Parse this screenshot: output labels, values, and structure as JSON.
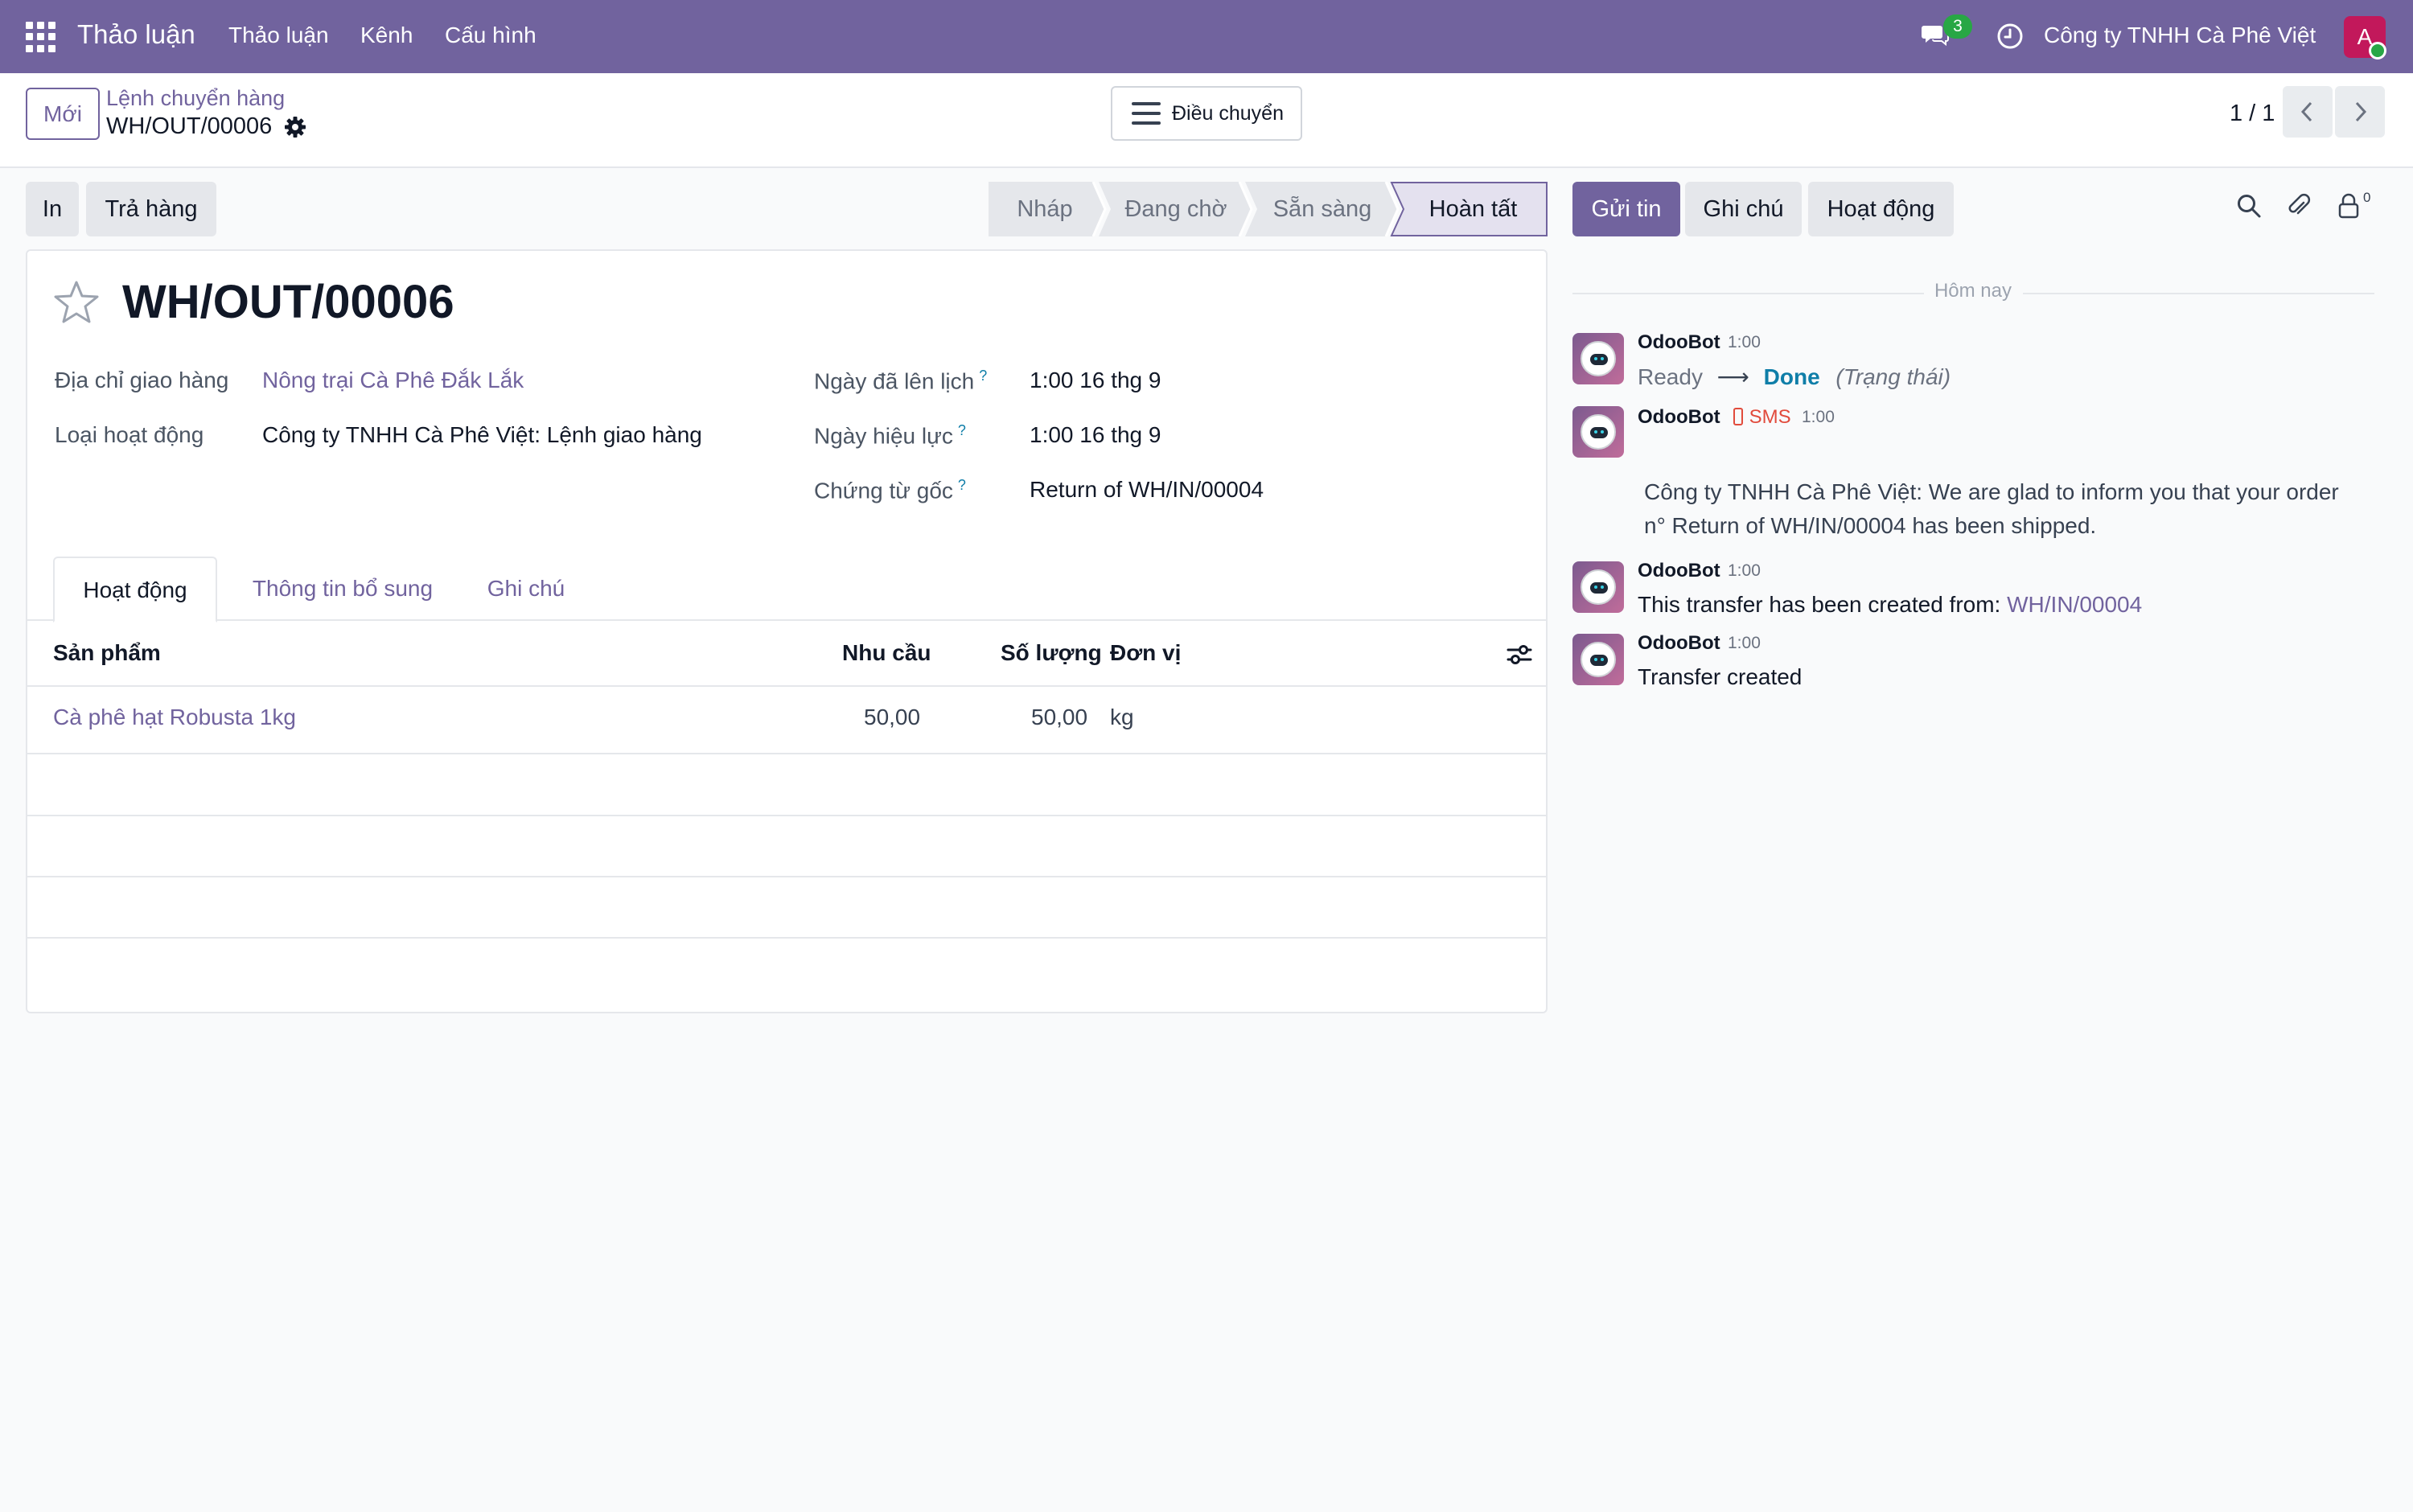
{
  "navbar": {
    "app_name": "Thảo luận",
    "menu": [
      "Thảo luận",
      "Kênh",
      "Cấu hình"
    ],
    "chat_badge": "3",
    "company": "Công ty TNHH Cà Phê Việt",
    "avatar_letter": "A"
  },
  "control": {
    "new_button": "Mới",
    "breadcrumb_parent": "Lệnh chuyển hàng",
    "record_name": "WH/OUT/00006",
    "transfer_button": "Điều chuyển",
    "pager": "1 / 1"
  },
  "actions": {
    "print": "In",
    "return": "Trả hàng"
  },
  "statusbar": {
    "steps": [
      "Nháp",
      "Đang chờ",
      "Sẵn sàng",
      "Hoàn tất"
    ],
    "active_step": "Hoàn tất"
  },
  "form": {
    "title": "WH/OUT/00006",
    "delivery_address_label": "Địa chỉ giao hàng",
    "delivery_address_value": "Nông trại Cà Phê Đắk Lắk",
    "operation_type_label": "Loại hoạt động",
    "operation_type_value": "Công ty TNHH Cà Phê Việt: Lệnh giao hàng",
    "scheduled_date_label": "Ngày đã lên lịch",
    "scheduled_date_value": "1:00 16 thg 9",
    "effective_date_label": "Ngày hiệu lực",
    "effective_date_value": "1:00 16 thg 9",
    "source_document_label": "Chứng từ gốc",
    "source_document_value": "Return of WH/IN/00004",
    "help_mark": "?"
  },
  "tabs": [
    "Hoạt động",
    "Thông tin bổ sung",
    "Ghi chú"
  ],
  "table": {
    "headers": {
      "product": "Sản phẩm",
      "demand": "Nhu cầu",
      "quantity": "Số lượng",
      "unit": "Đơn vị"
    },
    "rows": [
      {
        "product": "Cà phê hạt Robusta 1kg",
        "demand": "50,00",
        "quantity": "50,00",
        "unit": "kg"
      }
    ]
  },
  "chatter": {
    "send_message": "Gửi tin",
    "log_note": "Ghi chú",
    "activity": "Hoạt động",
    "follower_count": "0",
    "date_separator": "Hôm nay",
    "messages": [
      {
        "author": "OdooBot",
        "time": "1:00",
        "from": "Ready",
        "arrow": "⟶",
        "to": "Done",
        "field": "(Trạng thái)"
      },
      {
        "author": "OdooBot",
        "sms": "SMS",
        "time": "1:00",
        "line1": "Công ty TNHH Cà Phê Việt: We are glad to inform you that your order",
        "line2": "n° Return of WH/IN/00004 has been shipped."
      },
      {
        "author": "OdooBot",
        "time": "1:00",
        "text": "This transfer has been created from:",
        "link": "WH/IN/00004"
      },
      {
        "author": "OdooBot",
        "time": "1:00",
        "text": "Transfer created"
      }
    ]
  },
  "colors": {
    "brand": "#71639e",
    "success": "#28a745",
    "link_teal": "#0f7ea8",
    "sms_red": "#e14b3c"
  },
  "icons": [
    "apps-grid-icon",
    "chat-icon",
    "clock-icon",
    "gear-icon",
    "menu-icon",
    "chevron-left-icon",
    "chevron-right-icon",
    "star-icon",
    "settings-sliders-icon",
    "search-icon",
    "paperclip-icon",
    "follower-lock-icon",
    "phone-icon"
  ]
}
